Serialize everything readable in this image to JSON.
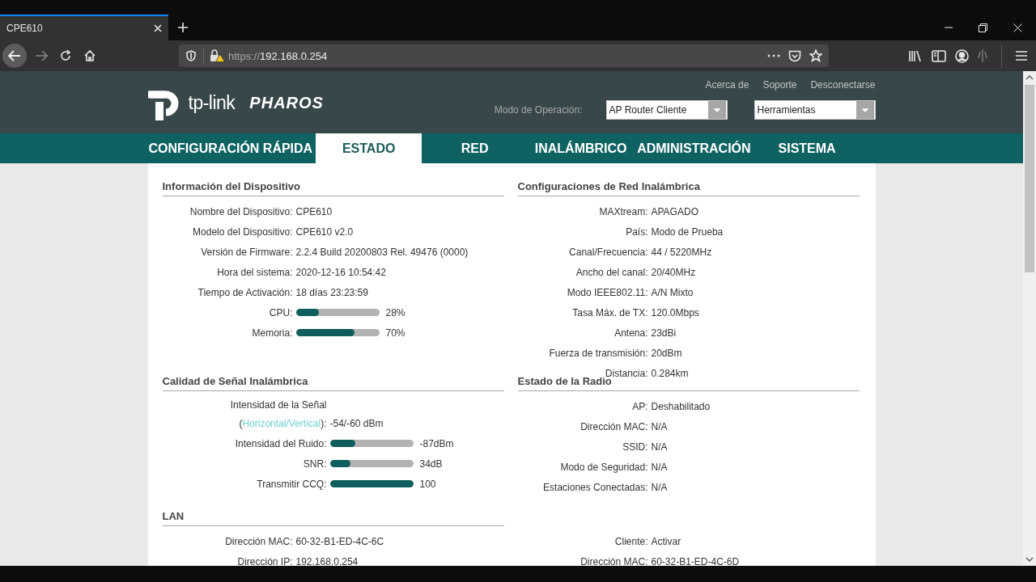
{
  "browser": {
    "tab": {
      "title": "CPE610",
      "selected": true
    },
    "address": {
      "scheme": "https://",
      "host": "192.168.0.254"
    }
  },
  "header": {
    "logo": {
      "wordmark": "tp-link",
      "product": "PHAROS"
    },
    "top_links": [
      "Acerca de",
      "Soporte",
      "Desconectarse"
    ],
    "mode_label": "Modo de Operación:",
    "mode_select": {
      "value": "AP Router Cliente"
    },
    "tools_select": {
      "value": "Herramientas"
    }
  },
  "nav": [
    {
      "label": "CONFIGURACIÓN RÁPIDA",
      "selected": false
    },
    {
      "label": "ESTADO",
      "selected": true
    },
    {
      "label": "RED",
      "selected": false
    },
    {
      "label": "INALÁMBRICO",
      "selected": false
    },
    {
      "label": "ADMINISTRACIÓN",
      "selected": false
    },
    {
      "label": "SISTEMA",
      "selected": false
    }
  ],
  "section_rows": [
    {
      "left": {
        "kind": "info",
        "title": "Información del Dispositivo",
        "rows": [
          {
            "kind": "text",
            "label": "Nombre del Dispositivo:",
            "value": "CPE610"
          },
          {
            "kind": "text",
            "label": "Modelo del Dispositivo:",
            "value": "CPE610 v2.0"
          },
          {
            "kind": "text",
            "label": "Versión de Firmware:",
            "value": "2.2.4 Build 20200803 Rel. 49476 (0000)"
          },
          {
            "kind": "text",
            "label": "Hora del sistema:",
            "value": "2020-12-16 10:54:42"
          },
          {
            "kind": "text",
            "label": "Tiempo de Activación:",
            "value": "18 días 23:23:59"
          },
          {
            "kind": "bar",
            "label": "CPU:",
            "level": 0.28,
            "value": "28%"
          },
          {
            "kind": "bar",
            "label": "Memoria:",
            "level": 0.7,
            "value": "70%"
          }
        ]
      },
      "right": {
        "kind": "info",
        "title": "Configuraciones de Red Inalámbrica",
        "rows": [
          {
            "kind": "text",
            "label": "MAXtream:",
            "value": "APAGADO"
          },
          {
            "kind": "text",
            "label": "País:",
            "value": "Modo de Prueba"
          },
          {
            "kind": "text",
            "label": "Canal/Frecuencia:",
            "value": "44 / 5220MHz"
          },
          {
            "kind": "text",
            "label": "Ancho del canal:",
            "value": "20/40MHz"
          },
          {
            "kind": "text",
            "label": "Modo IEEE802.11:",
            "value": "A/N Mixto"
          },
          {
            "kind": "text",
            "label": "Tasa Máx. de TX:",
            "value": "120.0Mbps"
          },
          {
            "kind": "text",
            "label": "Antena:",
            "value": "23dBi"
          },
          {
            "kind": "text",
            "label": "Fuerza de transmisión:",
            "value": "20dBm"
          },
          {
            "kind": "text",
            "label": "Distancia:",
            "value": "0.284km"
          }
        ]
      }
    },
    {
      "left": {
        "kind": "signal",
        "title": "Calidad de Señal Inalámbrica",
        "rows": [
          {
            "kind": "label",
            "label": "Intensidad de la Señal"
          },
          {
            "kind": "linked",
            "prefix": "(",
            "link": "Horizontal/Vertical",
            "suffix": "):",
            "value": "-54/-60 dBm"
          },
          {
            "kind": "bar",
            "label": "Intensidad del Ruido:",
            "level": 0.31,
            "value": "-87dBm"
          },
          {
            "kind": "bar",
            "label": "SNR:",
            "level": 0.25,
            "value": "34dB"
          },
          {
            "kind": "bar",
            "label": "Transmitir CCQ:",
            "level": 1,
            "value": "100"
          }
        ]
      },
      "right": {
        "kind": "info",
        "title": "Estado de la Radio",
        "rows": [
          {
            "kind": "text",
            "label": "AP:",
            "value": "Deshabilitado"
          },
          {
            "kind": "text",
            "label": "Dirección MAC:",
            "value": "N/A"
          },
          {
            "kind": "text",
            "label": "SSID:",
            "value": "N/A"
          },
          {
            "kind": "text",
            "label": "Modo de Seguridad:",
            "value": "N/A"
          },
          {
            "kind": "text",
            "label": "Estaciones Conectadas:",
            "value": "N/A"
          }
        ]
      }
    },
    {
      "left": {
        "kind": "info",
        "title": "LAN",
        "rows": [
          {
            "kind": "text",
            "label": "Dirección MAC:",
            "value": "60-32-B1-ED-4C-6C"
          },
          {
            "kind": "text",
            "label": "Dirección IP:",
            "value": "192.168.0.254"
          }
        ]
      },
      "right": {
        "kind": "info",
        "rows": [
          {
            "kind": "text",
            "label": "Cliente:",
            "value": "Activar"
          },
          {
            "kind": "text",
            "label": "Dirección MAC:",
            "value": "60-32-B1-ED-4C-6D"
          }
        ]
      }
    }
  ]
}
